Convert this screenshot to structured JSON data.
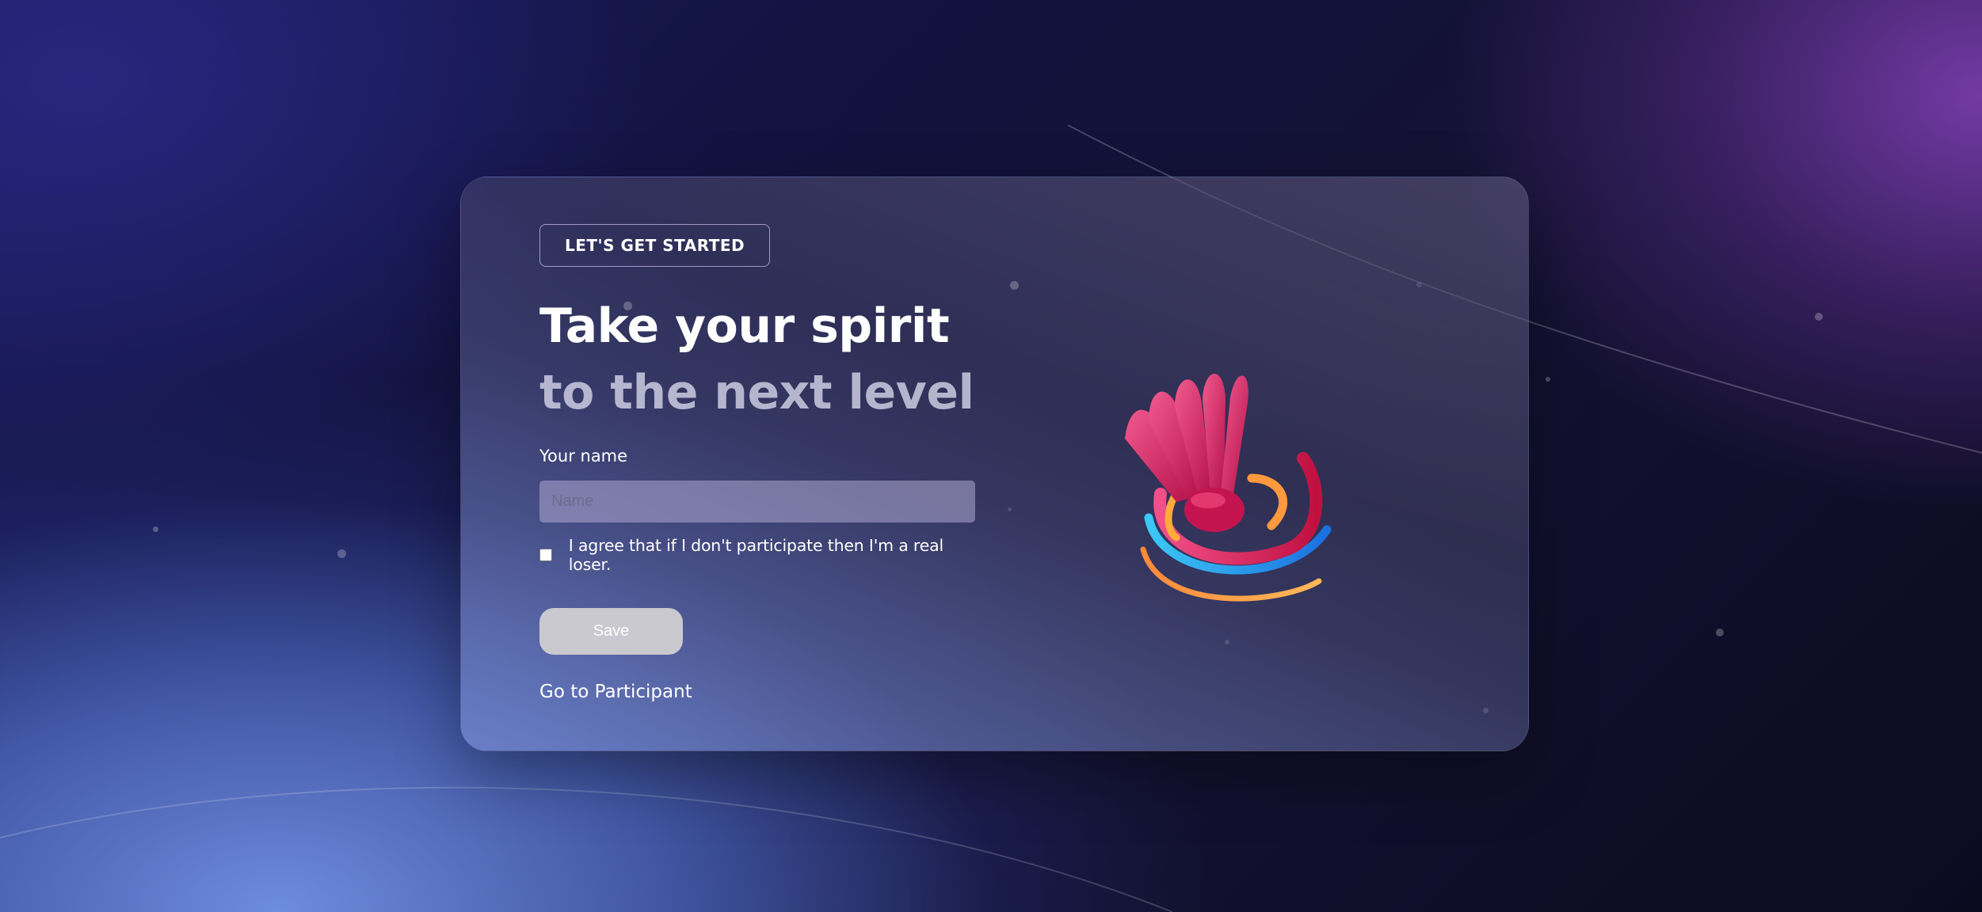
{
  "card": {
    "badge": "LET'S GET STARTED",
    "headline_line1": "Take your spirit",
    "headline_line2": "to the next level",
    "name_label": "Your name",
    "name_placeholder": "Name",
    "name_value": "",
    "agree_checked": false,
    "agree_text": "I agree that if I don't participate then I'm a real loser.",
    "save_label": "Save",
    "participant_link": "Go to Participant"
  },
  "logo": {
    "icon": "badminton-shuttlecock-icon"
  },
  "colors": {
    "shuttle_pink": "#e0306e",
    "swoosh_orange": "#ff9a3c",
    "swoosh_blue": "#1aa8f0",
    "save_button": "#c9c9cf"
  }
}
